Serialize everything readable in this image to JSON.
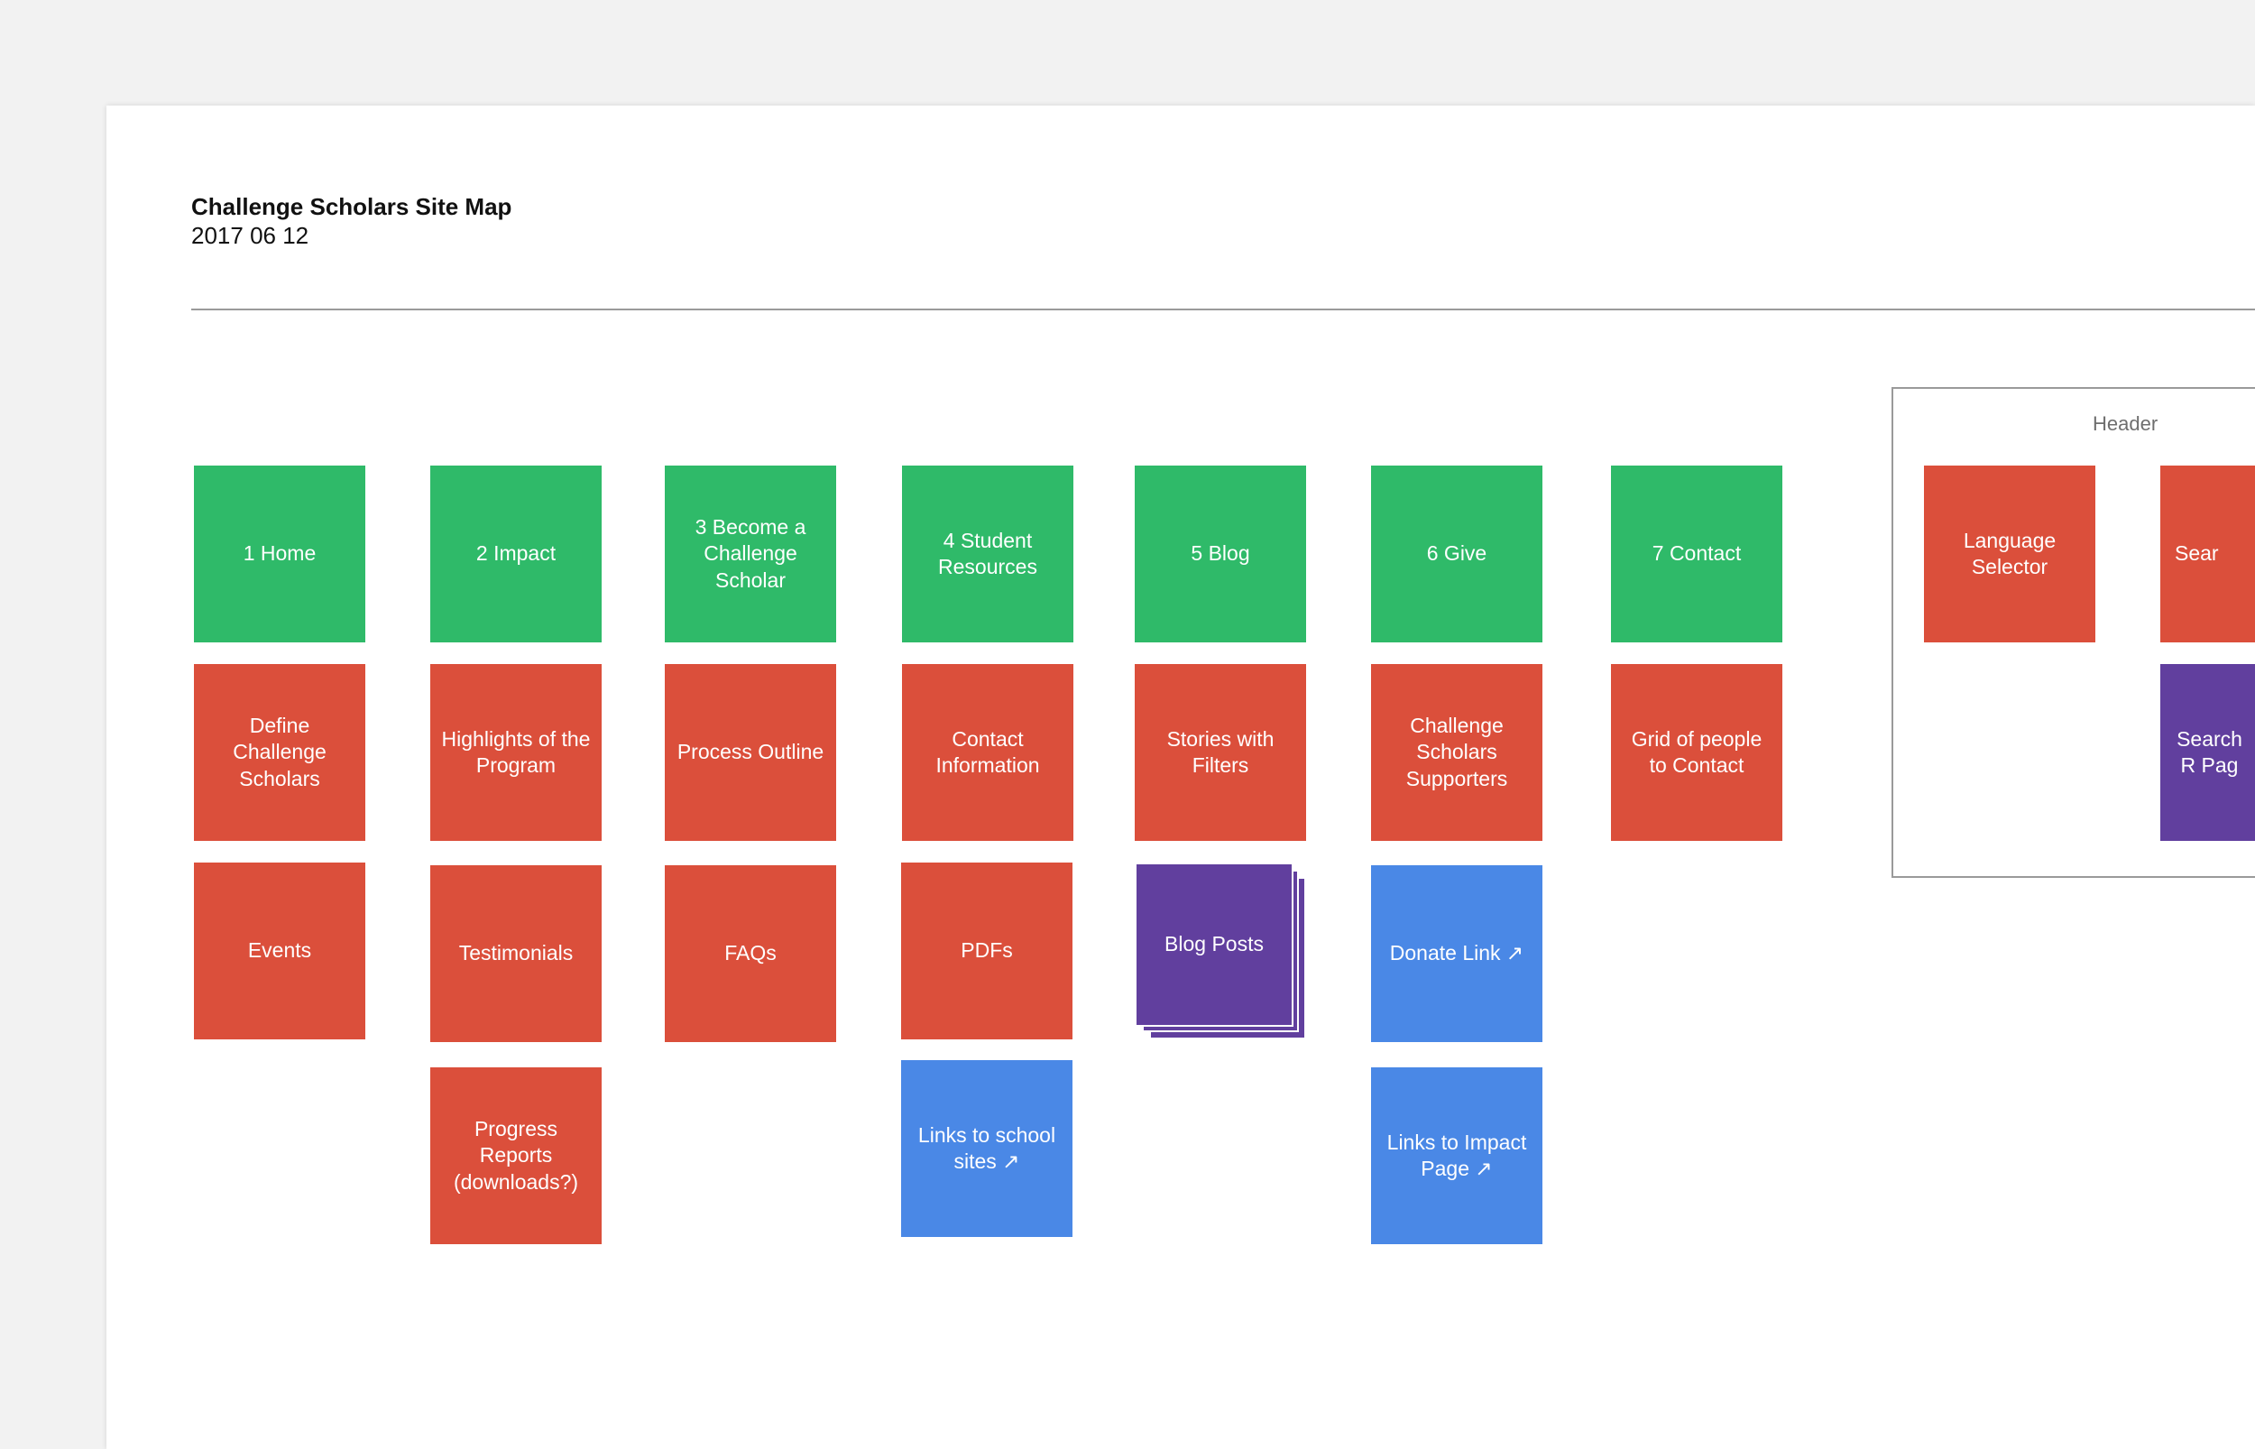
{
  "colors": {
    "page": "#ffffff",
    "canvas": "#f2f2f2",
    "page_node": "#2fba69",
    "content_node": "#db4f3b",
    "external_link_node": "#4a88e6",
    "collection_node": "#613f9e",
    "divider": "#9a9a9a"
  },
  "document": {
    "title": "Challenge Scholars Site Map",
    "date": "2017 06 12"
  },
  "header_group": {
    "label": "Header"
  },
  "nodes": [
    {
      "label": "1 Home",
      "kind": "page"
    },
    {
      "label": "2 Impact",
      "kind": "page"
    },
    {
      "label": "3 Become a Challenge Scholar",
      "kind": "page"
    },
    {
      "label": "4 Student Resources",
      "kind": "page"
    },
    {
      "label": "5 Blog",
      "kind": "page"
    },
    {
      "label": "6 Give",
      "kind": "page"
    },
    {
      "label": "7 Contact",
      "kind": "page"
    },
    {
      "label": "Define Challenge Scholars",
      "kind": "content"
    },
    {
      "label": "Highlights of the Program",
      "kind": "content"
    },
    {
      "label": "Process Outline",
      "kind": "content"
    },
    {
      "label": "Contact Information",
      "kind": "content"
    },
    {
      "label": "Stories with Filters",
      "kind": "content"
    },
    {
      "label": "Challenge Scholars Supporters",
      "kind": "content"
    },
    {
      "label": "Grid of people to Contact",
      "kind": "content"
    },
    {
      "label": "Events",
      "kind": "content"
    },
    {
      "label": "Testimonials",
      "kind": "content"
    },
    {
      "label": "FAQs",
      "kind": "content"
    },
    {
      "label": "PDFs",
      "kind": "content"
    },
    {
      "label": "Blog Posts",
      "kind": "collection"
    },
    {
      "label": "Donate Link ↗︎",
      "kind": "external_link"
    },
    {
      "label": "Progress Reports (downloads?)",
      "kind": "content"
    },
    {
      "label": "Links to school sites ↗︎",
      "kind": "external_link"
    },
    {
      "label": "Links to Impact Page ↗︎",
      "kind": "external_link"
    },
    {
      "label": "Language Selector",
      "kind": "content"
    },
    {
      "label": "Sear",
      "kind": "content"
    },
    {
      "label": "Search R Pag",
      "kind": "collection"
    }
  ]
}
